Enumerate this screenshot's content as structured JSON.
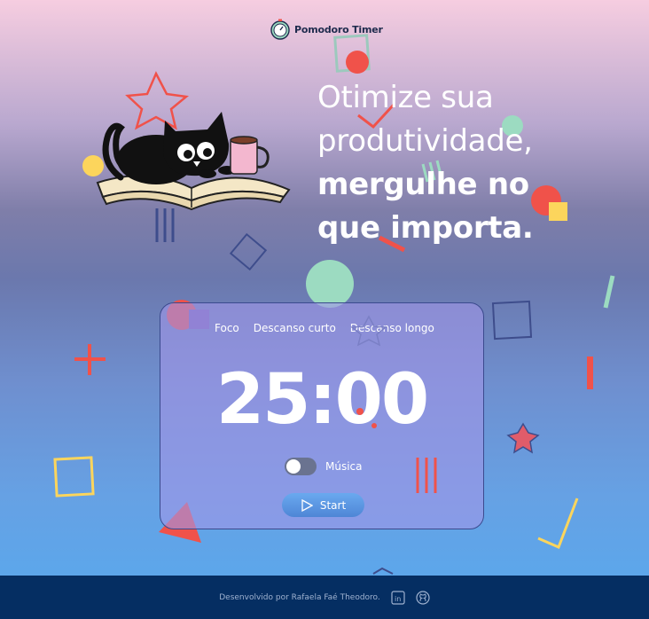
{
  "app": {
    "logo_text": "Pomodoro Timer",
    "logo_icon": "stopwatch-icon"
  },
  "hero": {
    "line1": "Otimize sua",
    "line2": "produtividade,",
    "line3": "mergulhe no",
    "line4": "que importa."
  },
  "timer_card": {
    "tabs": [
      {
        "label": "Foco"
      },
      {
        "label": "Descanso curto"
      },
      {
        "label": "Descanso longo"
      }
    ],
    "time": "25:00",
    "music_label": "Música",
    "music_enabled": false,
    "start_label": "Start",
    "start_icon": "play-icon"
  },
  "footer": {
    "credit": "Desenvolvido por Rafaela Faé Theodoro.",
    "icons": [
      "linkedin-icon",
      "github-icon"
    ]
  },
  "colors": {
    "accent_red": "#f0524a",
    "accent_yellow": "#fcd55c",
    "accent_mint": "#9cdbc1",
    "accent_navy": "#3e4d8c",
    "footer_bg": "#052e62"
  }
}
